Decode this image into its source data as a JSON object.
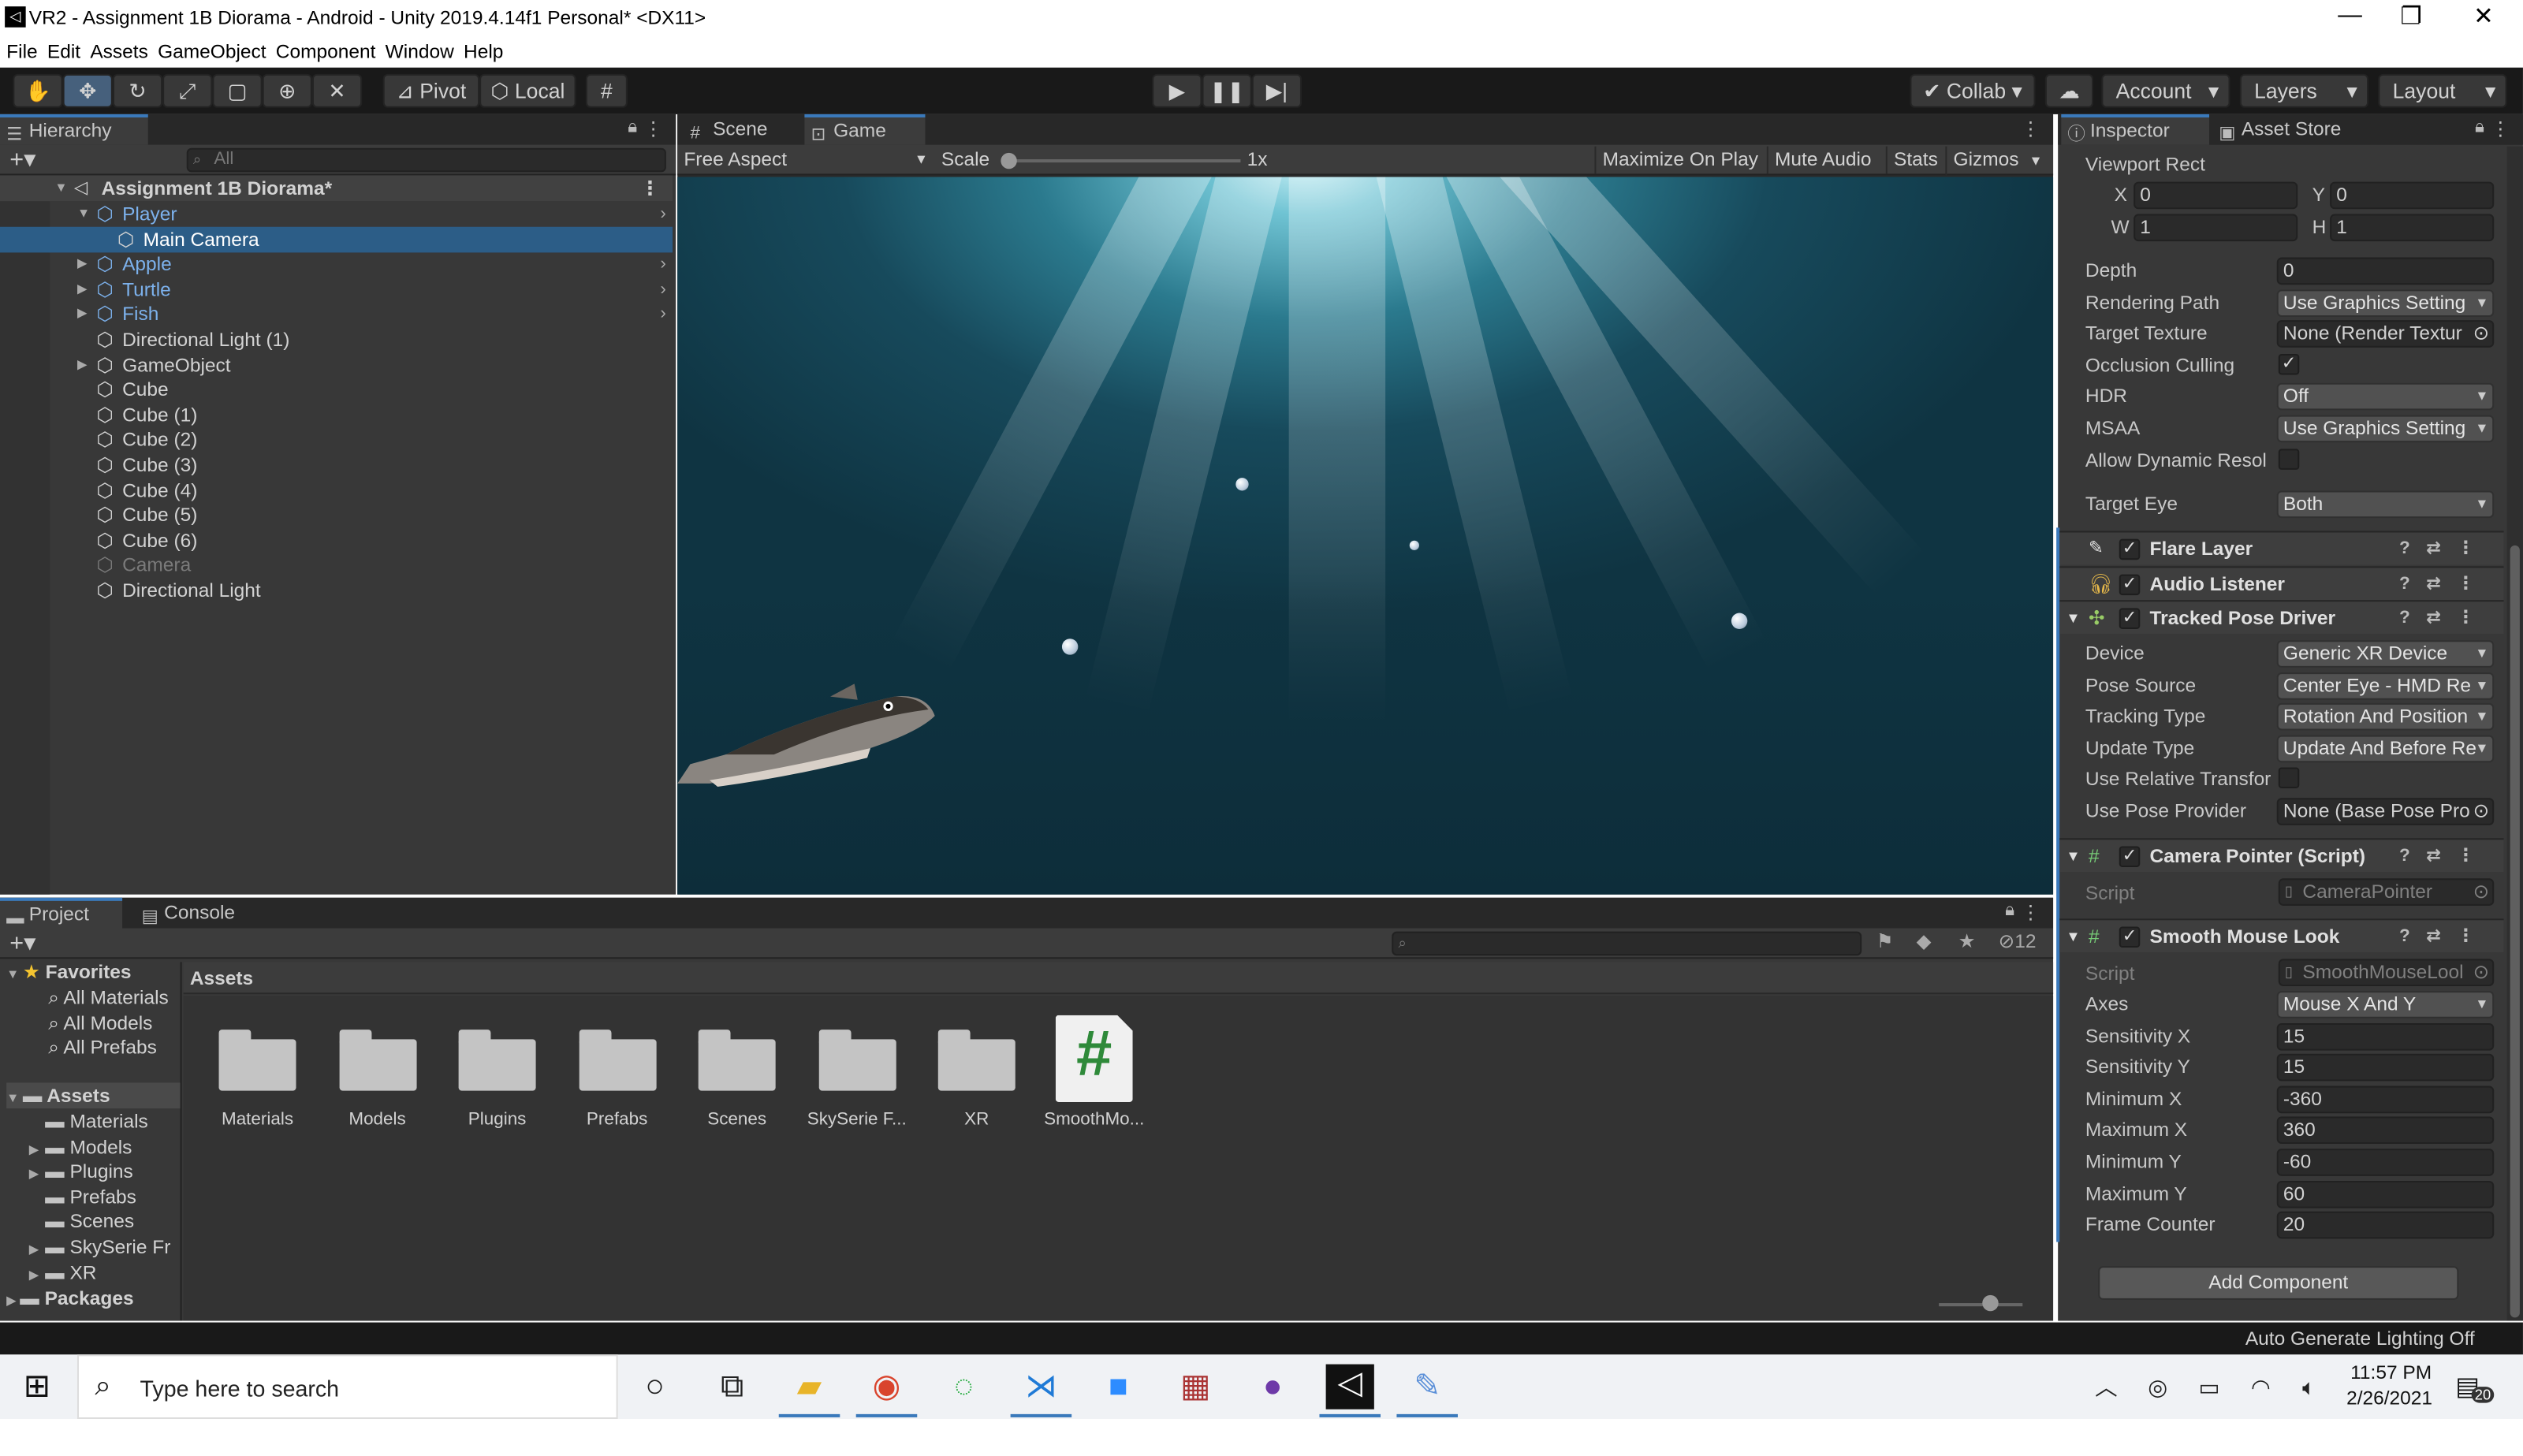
{
  "window": {
    "title": "VR2 - Assignment 1B Diorama - Android - Unity 2019.4.14f1 Personal* <DX11>",
    "controls": [
      "—",
      "❐",
      "✕"
    ]
  },
  "menu": [
    "File",
    "Edit",
    "Assets",
    "GameObject",
    "Component",
    "Window",
    "Help"
  ],
  "toolbar": {
    "pivot": "Pivot",
    "local": "Local",
    "collab": "Collab",
    "account": "Account",
    "layers": "Layers",
    "layout": "Layout"
  },
  "hierarchy": {
    "tab": "Hierarchy",
    "search_placeholder": "All",
    "scene": "Assignment 1B Diorama*",
    "items": [
      {
        "label": "Player",
        "style": "blue",
        "fold": "open",
        "indent": 1
      },
      {
        "label": "Main Camera",
        "style": "selected",
        "fold": "",
        "indent": 2
      },
      {
        "label": "Apple",
        "style": "blue",
        "fold": "closed",
        "indent": 1
      },
      {
        "label": "Turtle",
        "style": "blue",
        "fold": "closed",
        "indent": 1
      },
      {
        "label": "Fish",
        "style": "blue",
        "fold": "closed",
        "indent": 1
      },
      {
        "label": "Directional Light (1)",
        "style": "normal",
        "fold": "",
        "indent": 1
      },
      {
        "label": "GameObject",
        "style": "normal",
        "fold": "closed",
        "indent": 1
      },
      {
        "label": "Cube",
        "style": "normal",
        "fold": "",
        "indent": 1
      },
      {
        "label": "Cube (1)",
        "style": "normal",
        "fold": "",
        "indent": 1
      },
      {
        "label": "Cube (2)",
        "style": "normal",
        "fold": "",
        "indent": 1
      },
      {
        "label": "Cube (3)",
        "style": "normal",
        "fold": "",
        "indent": 1
      },
      {
        "label": "Cube (4)",
        "style": "normal",
        "fold": "",
        "indent": 1
      },
      {
        "label": "Cube (5)",
        "style": "normal",
        "fold": "",
        "indent": 1
      },
      {
        "label": "Cube (6)",
        "style": "normal",
        "fold": "",
        "indent": 1
      },
      {
        "label": "Camera",
        "style": "disabled",
        "fold": "",
        "indent": 1
      },
      {
        "label": "Directional Light",
        "style": "normal",
        "fold": "",
        "indent": 1
      }
    ]
  },
  "game": {
    "tab_scene": "Scene",
    "tab_game": "Game",
    "aspect": "Free Aspect",
    "scale_label": "Scale",
    "scale_value": "1x",
    "maximize": "Maximize On Play",
    "mute": "Mute Audio",
    "stats": "Stats",
    "gizmos": "Gizmos"
  },
  "inspector": {
    "tab": "Inspector",
    "tab_store": "Asset Store",
    "viewport_rect": "Viewport Rect",
    "x_label": "X",
    "x_value": "0",
    "y_label": "Y",
    "y_value": "0",
    "w_label": "W",
    "w_value": "1",
    "h_label": "H",
    "h_value": "1",
    "camera_props": [
      {
        "label": "Depth",
        "value": "0",
        "kind": "field"
      },
      {
        "label": "Rendering Path",
        "value": "Use Graphics Setting",
        "kind": "drop"
      },
      {
        "label": "Target Texture",
        "value": "None (Render Textur",
        "kind": "object"
      },
      {
        "label": "Occlusion Culling",
        "value": "✓",
        "kind": "check"
      },
      {
        "label": "HDR",
        "value": "Off",
        "kind": "drop"
      },
      {
        "label": "MSAA",
        "value": "Use Graphics Setting",
        "kind": "drop"
      },
      {
        "label": "Allow Dynamic Resol",
        "value": "",
        "kind": "check"
      },
      {
        "label": "Target Eye",
        "value": "Both",
        "kind": "drop"
      }
    ],
    "flare_layer": "Flare Layer",
    "audio_listener": "Audio Listener",
    "tracked_pose_driver": "Tracked Pose Driver",
    "tpd_props": [
      {
        "label": "Device",
        "value": "Generic XR Device",
        "kind": "drop"
      },
      {
        "label": "Pose Source",
        "value": "Center Eye - HMD Re",
        "kind": "drop"
      },
      {
        "label": "Tracking Type",
        "value": "Rotation And Position",
        "kind": "drop"
      },
      {
        "label": "Update Type",
        "value": "Update And Before Re",
        "kind": "drop"
      },
      {
        "label": "Use Relative Transfor",
        "value": "",
        "kind": "check"
      },
      {
        "label": "Use Pose Provider",
        "value": "None (Base Pose Pro",
        "kind": "object"
      }
    ],
    "camera_pointer": "Camera Pointer (Script)",
    "cp_script_label": "Script",
    "cp_script_value": "CameraPointer",
    "smooth_mouse_look": "Smooth Mouse Look",
    "sml_script_label": "Script",
    "sml_script_value": "SmoothMouseLool",
    "sml_props": [
      {
        "label": "Axes",
        "value": "Mouse X And Y",
        "kind": "drop"
      },
      {
        "label": "Sensitivity X",
        "value": "15",
        "kind": "field"
      },
      {
        "label": "Sensitivity Y",
        "value": "15",
        "kind": "field"
      },
      {
        "label": "Minimum X",
        "value": "-360",
        "kind": "field"
      },
      {
        "label": "Maximum X",
        "value": "360",
        "kind": "field"
      },
      {
        "label": "Minimum Y",
        "value": "-60",
        "kind": "field"
      },
      {
        "label": "Maximum Y",
        "value": "60",
        "kind": "field"
      },
      {
        "label": "Frame Counter",
        "value": "20",
        "kind": "field"
      }
    ],
    "add_component": "Add Component"
  },
  "project": {
    "tab": "Project",
    "tab_console": "Console",
    "hidden_count": "12",
    "breadcrumb": "Assets",
    "favorites": "Favorites",
    "fav_items": [
      "All Materials",
      "All Models",
      "All Prefabs"
    ],
    "assets_root": "Assets",
    "asset_tree": [
      "Materials",
      "Models",
      "Plugins",
      "Prefabs",
      "Scenes",
      "SkySerie Fr",
      "XR"
    ],
    "packages": "Packages",
    "grid": [
      "Materials",
      "Models",
      "Plugins",
      "Prefabs",
      "Scenes",
      "SkySerie F...",
      "XR"
    ],
    "script_item": "SmoothMo...",
    "script_glyph": "#"
  },
  "status": {
    "text": "Auto Generate Lighting Off"
  },
  "taskbar": {
    "search_placeholder": "Type here to search",
    "time": "11:57 PM",
    "date": "2/26/2021",
    "notif_count": "20"
  }
}
